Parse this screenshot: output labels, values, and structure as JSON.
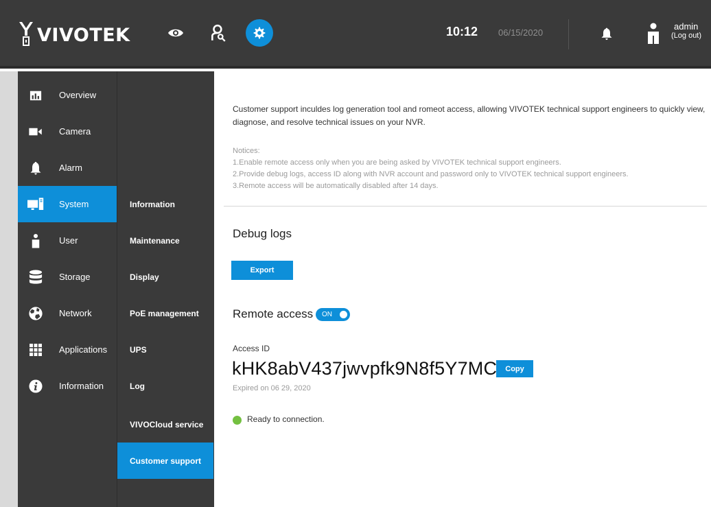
{
  "header": {
    "brand": "VIVOTEK",
    "time": "10:12",
    "date": "06/15/2020",
    "user": "admin",
    "logout_label": "(Log out)",
    "nav_icons": [
      "eye-icon",
      "search-user-icon",
      "gear-icon"
    ]
  },
  "left_nav": {
    "items": [
      {
        "label": "Overview",
        "icon": "bar-chart-icon"
      },
      {
        "label": "Camera",
        "icon": "camera-icon"
      },
      {
        "label": "Alarm",
        "icon": "bell-icon"
      },
      {
        "label": "System",
        "icon": "monitor-icon",
        "active": true
      },
      {
        "label": "User",
        "icon": "user-icon"
      },
      {
        "label": "Storage",
        "icon": "database-icon"
      },
      {
        "label": "Network",
        "icon": "globe-icon"
      },
      {
        "label": "Applications",
        "icon": "grid-icon"
      },
      {
        "label": "Information",
        "icon": "info-icon"
      }
    ]
  },
  "sub_nav": {
    "items": [
      {
        "label": "Information"
      },
      {
        "label": "Maintenance"
      },
      {
        "label": "Display"
      },
      {
        "label": "PoE management"
      },
      {
        "label": "UPS"
      },
      {
        "label": "Log"
      },
      {
        "label": "VIVOCloud service"
      },
      {
        "label": "Customer support",
        "active": true
      }
    ]
  },
  "main": {
    "intro": "Customer support inculdes log generation tool and romeot access, allowing VIVOTEK technical support engineers to quickly view, diagnose, and resolve technical issues on your NVR.",
    "notices_title": "Notices:",
    "notices": [
      "1.Enable remote access only when you are being asked by VIVOTEK technical support engineers.",
      "2.Provide debug logs, access ID along with NVR account and password only to VIVOTEK technical support engineers.",
      "3.Remote access will be automatically disabled after 14 days."
    ],
    "debug_title": "Debug logs",
    "export_label": "Export",
    "remote_title": "Remote access",
    "toggle_label": "ON",
    "access_id_label": "Access ID",
    "access_id": "kHK8abV437jwvpfk9N8f5Y7MC",
    "copy_label": "Copy",
    "expired": "Expired on 06 29, 2020",
    "status": "Ready to connection."
  },
  "colors": {
    "accent": "#0e8fd9",
    "bar": "#3a3a3a",
    "status_ok": "#74c041"
  }
}
